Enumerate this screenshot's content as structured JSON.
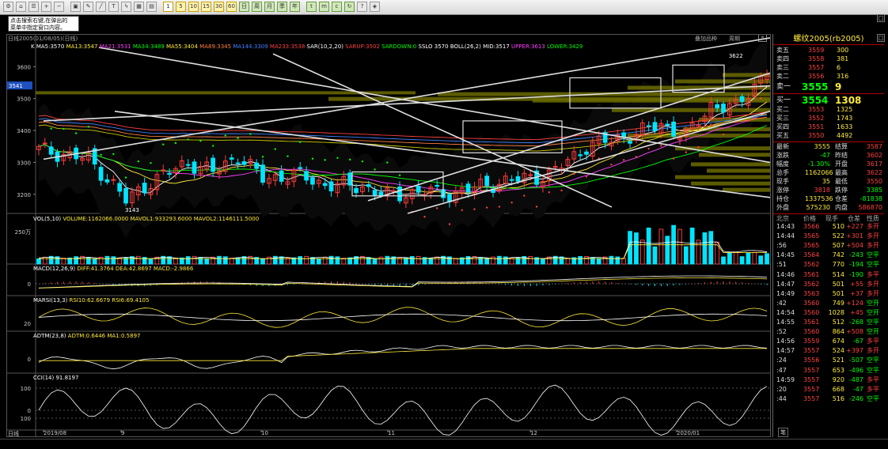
{
  "infobox": {
    "line1": "点击搜索右键,在弹出的",
    "line2": "菜单中指定窗口内容。"
  },
  "chart": {
    "header_left": "日线2005(01/08/05)(日线)",
    "header_btn1": "叠加品种",
    "header_btn2": "周期",
    "ma_line": {
      "k": "K",
      "ma5": "MA5:3570",
      "ma13": "MA13:3547",
      "ma21": "MA21:3531",
      "ma34": "MA34:3489",
      "ma55": "MA55:3404",
      "ma89": "MA89:3345",
      "ma144": "MA144:3309",
      "ma233": "MA233:3538",
      "sar": "SAR(10,2,20)",
      "sarup": "SARUP:3502",
      "sardown": "SARDOWN:0",
      "sslo": "SSLO 3570",
      "boll": "BOLL(26,2)",
      "mid": "MID:3517",
      "upper": "UPPER:3613",
      "lower": "LOWER:3429"
    },
    "price_ticks": [
      "3600",
      "3500",
      "3400",
      "3300",
      "3200"
    ],
    "price_marker": "3541",
    "low_label": "3143",
    "high_label": "3622",
    "vol_label": "VOL(5,10)",
    "vol_values": "VOLUME:1162066.0000  MAVOL1:933293.6000  MAVOL2:1146111.5000",
    "vol_tick": "250万",
    "macd_label": "MACD(12,26,9)",
    "macd_values": "DIFF:41.3764  DEA:42.8697  MACD:-2.9866",
    "macd_tick": "0",
    "rsi_label": "MARSI(13,3)",
    "rsi_values": "RSI10:62.6679  RSI6:69.4105",
    "rsi_tick": "20",
    "adtm_label": "ADTM(23,8)",
    "adtm_values": "ADTM:0.6446  MA1:0.5897",
    "adtm_tick": "0",
    "cci_label": "CCI(14)",
    "cci_values": "91.8197",
    "cci_ticks": [
      "100",
      "0",
      "100"
    ],
    "date_ticks": [
      "2019/08",
      "9",
      "10",
      "11",
      "12",
      "2020/01"
    ],
    "period_label": "日线"
  },
  "quote": {
    "title": "螺纹2005(rb2005)",
    "asks": [
      {
        "label": "卖五",
        "price": "3559",
        "vol": "300"
      },
      {
        "label": "卖四",
        "price": "3558",
        "vol": "381"
      },
      {
        "label": "卖三",
        "price": "3557",
        "vol": "6"
      },
      {
        "label": "卖二",
        "price": "3556",
        "vol": "316"
      },
      {
        "label": "卖一",
        "price": "3555",
        "vol": "9"
      }
    ],
    "bids": [
      {
        "label": "买一",
        "price": "3554",
        "vol": "1308"
      },
      {
        "label": "买二",
        "price": "3553",
        "vol": "1325"
      },
      {
        "label": "买三",
        "price": "3552",
        "vol": "1743"
      },
      {
        "label": "买四",
        "price": "3551",
        "vol": "1633"
      },
      {
        "label": "买五",
        "price": "3550",
        "vol": "4492"
      }
    ],
    "stats": [
      {
        "l1": "最新",
        "v1": "3555",
        "l2": "结算",
        "v2": "3587"
      },
      {
        "l1": "涨跌",
        "v1": "-47",
        "l2": "昨结",
        "v2": "3602"
      },
      {
        "l1": "幅度",
        "v1": "-1.30%",
        "l2": "开盘",
        "v2": "3617"
      },
      {
        "l1": "总手",
        "v1": "1162066",
        "l2": "最高",
        "v2": "3622"
      },
      {
        "l1": "现手",
        "v1": "35",
        "l2": "最低",
        "v2": "3550"
      },
      {
        "l1": "涨停",
        "v1": "3818",
        "l2": "跌停",
        "v2": "3385"
      },
      {
        "l1": "持仓",
        "v1": "1337536",
        "l2": "仓差",
        "v2": "-81838"
      },
      {
        "l1": "外盘",
        "v1": "575230",
        "l2": "内盘",
        "v2": "586870"
      }
    ],
    "tick_headers": {
      "time": "北京",
      "price": "价格",
      "vol": "现手",
      "oi": "仓差",
      "type": "性质"
    },
    "ticks": [
      {
        "time": "14:43",
        "price": "3566",
        "vol": "510",
        "oi": "+227",
        "type": "多开"
      },
      {
        "time": "14:44",
        "price": "3565",
        "vol": "522",
        "oi": "+301",
        "type": "多开"
      },
      {
        "time": ":56",
        "price": "3565",
        "vol": "507",
        "oi": "+504",
        "type": "多开"
      },
      {
        "time": "14:45",
        "price": "3564",
        "vol": "742",
        "oi": "-243",
        "type": "空平"
      },
      {
        "time": ":51",
        "price": "3562",
        "vol": "770",
        "oi": "-194",
        "type": "空平"
      },
      {
        "time": "14:46",
        "price": "3561",
        "vol": "514",
        "oi": "-190",
        "type": "多平"
      },
      {
        "time": "14:47",
        "price": "3562",
        "vol": "501",
        "oi": "+55",
        "type": "多开"
      },
      {
        "time": "14:49",
        "price": "3563",
        "vol": "501",
        "oi": "+37",
        "type": "多开"
      },
      {
        "time": ":42",
        "price": "3560",
        "vol": "749",
        "oi": "+124",
        "type": "空开"
      },
      {
        "time": "14:54",
        "price": "3560",
        "vol": "1028",
        "oi": "+45",
        "type": "空开"
      },
      {
        "time": "14:55",
        "price": "3561",
        "vol": "512",
        "oi": "-268",
        "type": "空平"
      },
      {
        "time": ":52",
        "price": "3560",
        "vol": "864",
        "oi": "+508",
        "type": "空开"
      },
      {
        "time": "14:56",
        "price": "3559",
        "vol": "674",
        "oi": "-67",
        "type": "多平"
      },
      {
        "time": "14:57",
        "price": "3557",
        "vol": "524",
        "oi": "+397",
        "type": "多开"
      },
      {
        "time": ":24",
        "price": "3556",
        "vol": "521",
        "oi": "-507",
        "type": "空平"
      },
      {
        "time": ":47",
        "price": "3557",
        "vol": "653",
        "oi": "-496",
        "type": "空平"
      },
      {
        "time": "14:59",
        "price": "3557",
        "vol": "920",
        "oi": "-487",
        "type": "多平"
      },
      {
        "time": ":20",
        "price": "3557",
        "vol": "668",
        "oi": "-47",
        "type": "多平"
      },
      {
        "time": ":44",
        "price": "3557",
        "vol": "516",
        "oi": "-246",
        "type": "空平"
      }
    ],
    "bottom_tab": "笔"
  },
  "colors": {
    "up": "#ff3b3b",
    "down": "#00e5ff",
    "yellow": "#ffeb3b",
    "green": "#00ff00",
    "white": "#ffffff",
    "boll_band": "#6b6b00"
  }
}
